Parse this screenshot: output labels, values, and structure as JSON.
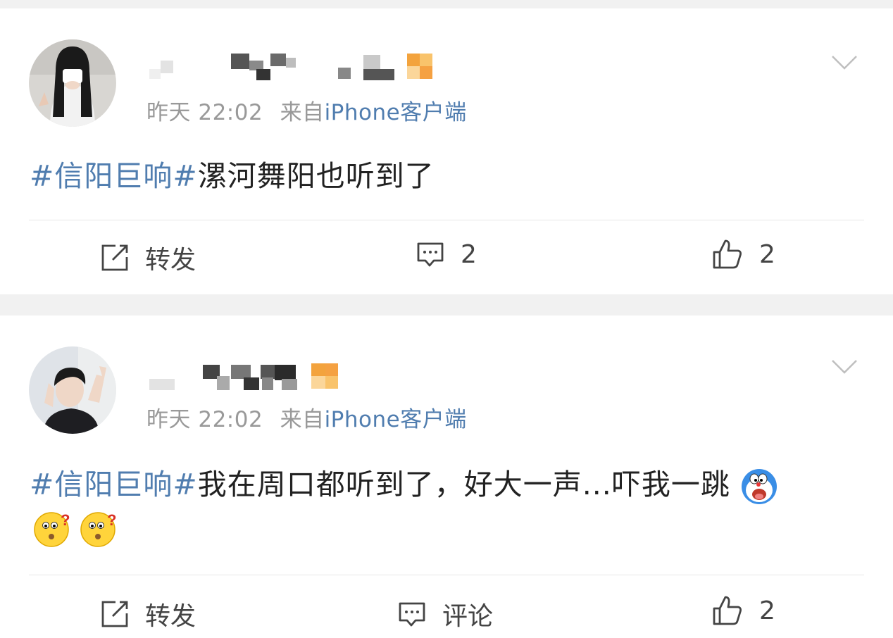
{
  "posts": [
    {
      "timestamp": "昨天 22:02",
      "source_prefix": "来自",
      "source_client": "iPhone客户端",
      "hashtag": "#信阳巨响#",
      "text": "漯河舞阳也听到了",
      "actions": {
        "repost": "转发",
        "comment": "2",
        "like": "2"
      },
      "icons": [
        "repost-icon",
        "comment-icon",
        "like-icon",
        "chevron-down-icon"
      ]
    },
    {
      "timestamp": "昨天 22:02",
      "source_prefix": "来自",
      "source_client": "iPhone客户端",
      "hashtag": "#信阳巨响#",
      "text": "我在周口都听到了，好大一声...吓我一跳",
      "actions": {
        "repost": "转发",
        "comment": "评论",
        "like": "2"
      },
      "icons": [
        "repost-icon",
        "comment-icon",
        "like-icon",
        "chevron-down-icon",
        "doraemon-emoji",
        "confused-emoji"
      ]
    }
  ],
  "colors": {
    "link": "#507daf",
    "meta": "#999999",
    "text": "#222222",
    "page_bg": "#f1f1f1",
    "vip_badge": "#f5a142"
  }
}
